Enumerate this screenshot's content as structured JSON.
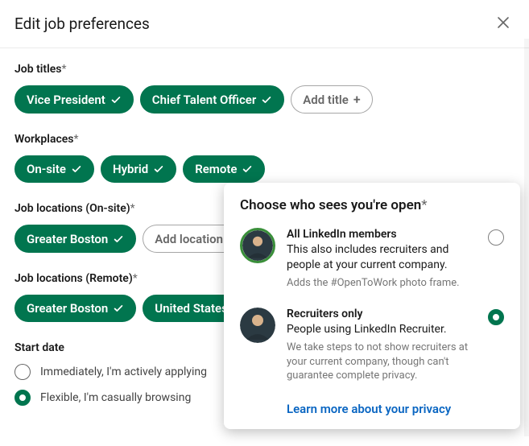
{
  "header": {
    "title": "Edit job preferences"
  },
  "sections": {
    "job_titles": {
      "label": "Job titles",
      "chips": [
        "Vice President",
        "Chief Talent Officer"
      ],
      "add_label": "Add title"
    },
    "workplaces": {
      "label": "Workplaces",
      "chips": [
        "On-site",
        "Hybrid",
        "Remote"
      ]
    },
    "locations_onsite": {
      "label": "Job locations (On-site)",
      "chips": [
        "Greater Boston"
      ],
      "add_label": "Add location"
    },
    "locations_remote": {
      "label": "Job locations (Remote)",
      "chips": [
        "Greater Boston",
        "United States"
      ]
    },
    "start_date": {
      "label": "Start date",
      "options": [
        {
          "label": "Immediately, I'm actively applying",
          "selected": false
        },
        {
          "label": "Flexible, I'm casually browsing",
          "selected": true
        }
      ]
    }
  },
  "popup": {
    "title": "Choose who sees you're open",
    "options": [
      {
        "title": "All LinkedIn members",
        "desc": "This also includes recruiters and people at your current company.",
        "sub": "Adds the #OpenToWork photo frame.",
        "selected": false
      },
      {
        "title": "Recruiters only",
        "desc": "People using LinkedIn Recruiter.",
        "sub": "We take steps to not show recruiters at your current company, though can't guarantee complete privacy.",
        "selected": true
      }
    ],
    "learn_more": "Learn more about your privacy"
  }
}
